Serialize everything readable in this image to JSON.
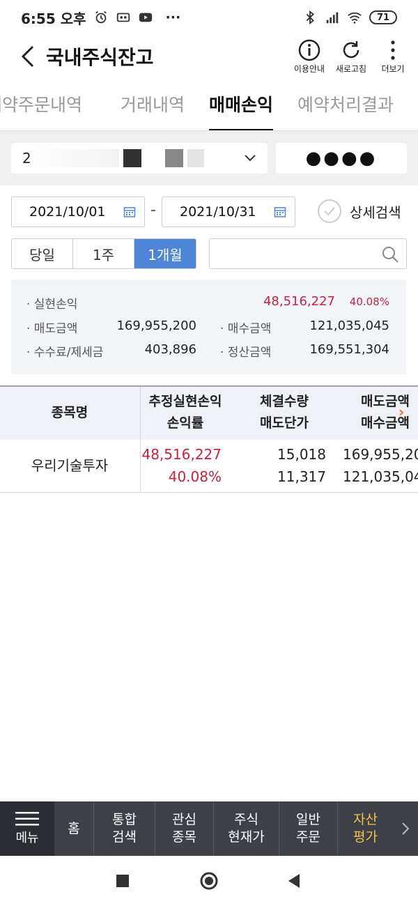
{
  "status_bar": {
    "time": "6:55 오후",
    "dots": "···",
    "battery": "71"
  },
  "header": {
    "title": "국내주식잔고",
    "actions": [
      {
        "label": "이용안내",
        "icon": "info-icon"
      },
      {
        "label": "새로고침",
        "icon": "refresh-icon"
      },
      {
        "label": "더보기",
        "icon": "more-vertical-icon"
      }
    ]
  },
  "tabs": [
    "예약주문내역",
    "거래내역",
    "매매손익",
    "예약처리결과"
  ],
  "active_tab": "매매손익",
  "account": {
    "prefix": "2",
    "password_mask": "●●●●"
  },
  "dates": {
    "start": "2021/10/01",
    "separator": "-",
    "end": "2021/10/31"
  },
  "detail_search_label": "상세검색",
  "periods": [
    "당일",
    "1주",
    "1개월"
  ],
  "active_period": "1개월",
  "summary": {
    "realized": {
      "label": "· 실현손익",
      "value": "48,516,227",
      "rate": "40.08%"
    },
    "sell_amount": {
      "label": "· 매도금액",
      "value": "169,955,200"
    },
    "buy_amount": {
      "label": "· 매수금액",
      "value": "121,035,045"
    },
    "fees": {
      "label": "· 수수료/제세금",
      "value": "403,896"
    },
    "settlement": {
      "label": "· 정산금액",
      "value": "169,551,304"
    }
  },
  "table": {
    "headers": {
      "name": "종목명",
      "pnl_top": "추정실현손익",
      "pnl_bottom": "손익률",
      "qty_top": "체결수량",
      "qty_bottom": "매도단가",
      "amt_top": "매도금액",
      "amt_bottom": "매수금액"
    },
    "rows": [
      {
        "name": "우리기술투자",
        "pnl": "48,516,227",
        "rate": "40.08%",
        "qty": "15,018",
        "sell_price": "11,317",
        "sell_amount": "169,955,20",
        "buy_amount": "121,035,04"
      }
    ]
  },
  "bottom_nav": {
    "menu_label": "메뉴",
    "items": [
      {
        "l1": "홈",
        "l2": ""
      },
      {
        "l1": "통합",
        "l2": "검색"
      },
      {
        "l1": "관심",
        "l2": "종목"
      },
      {
        "l1": "주식",
        "l2": "현재가"
      },
      {
        "l1": "일반",
        "l2": "주문"
      },
      {
        "l1": "자산",
        "l2": "평가"
      }
    ]
  },
  "colors": {
    "accent_blue": "#4d86d6",
    "profit_red": "#c4243f",
    "nav_bg": "#3d4049",
    "nav_active": "#f6c242"
  }
}
